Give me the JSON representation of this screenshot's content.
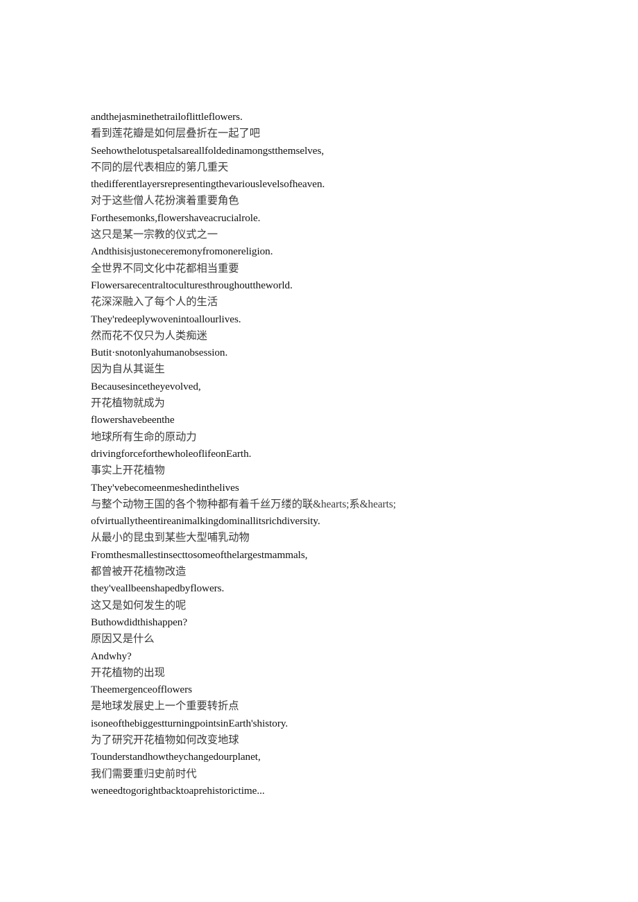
{
  "document": {
    "background_color": "#ffffff",
    "text_color_en": "#111111",
    "text_color_zh": "#3a3a3a",
    "lines": [
      {
        "lang": "en",
        "text": "andthejasminethetrailoflittleflowers."
      },
      {
        "lang": "zh",
        "text": "看到莲花瓣是如何层叠折在一起了吧"
      },
      {
        "lang": "en",
        "text": "Seehowthelotuspetalsareallfoldedinamongstthemselves,"
      },
      {
        "lang": "zh",
        "text": "不同的层代表相应的第几重天"
      },
      {
        "lang": "en",
        "text": "thedifferentlayersrepresentingthevariouslevelsofheaven."
      },
      {
        "lang": "zh",
        "text": "对于这些僧人花扮演着重要角色"
      },
      {
        "lang": "en",
        "text": "Forthesemonks,flowershaveacrucialrole."
      },
      {
        "lang": "zh",
        "text": "这只是某一宗教的仪式之一"
      },
      {
        "lang": "en",
        "text": "Andthisisjustoneceremonyfromonereligion."
      },
      {
        "lang": "zh",
        "text": "全世界不同文化中花都相当重要"
      },
      {
        "lang": "en",
        "text": "Flowersarecentraltoculturesthroughouttheworld."
      },
      {
        "lang": "zh",
        "text": "花深深融入了每个人的生活"
      },
      {
        "lang": "en",
        "text": "They'redeeplywovenintoallourlives."
      },
      {
        "lang": "zh",
        "text": "然而花不仅只为人类痴迷"
      },
      {
        "lang": "en",
        "text": "Butit·snotonlyahumanobsession."
      },
      {
        "lang": "zh",
        "text": "因为自从其诞生"
      },
      {
        "lang": "en",
        "text": "Becausesincetheyevolved,"
      },
      {
        "lang": "zh",
        "text": "开花植物就成为"
      },
      {
        "lang": "en",
        "text": "flowershavebeenthe"
      },
      {
        "lang": "zh",
        "text": "地球所有生命的原动力"
      },
      {
        "lang": "en",
        "text": "drivingforceforthewholeoflifeonEarth."
      },
      {
        "lang": "zh",
        "text": "事实上开花植物"
      },
      {
        "lang": "en",
        "text": "They'vebecomeenmeshedinthelives"
      },
      {
        "lang": "zh",
        "text": "与整个动物王国的各个物种都有着千丝万缕的联&hearts;系&hearts;"
      },
      {
        "lang": "en",
        "text": "ofvirtuallytheentireanimalkingdominallitsrichdiversity."
      },
      {
        "lang": "zh",
        "text": "从最小的昆虫到某些大型哺乳动物"
      },
      {
        "lang": "en",
        "text": "Fromthesmallestinsecttosomeofthelargestmammals,"
      },
      {
        "lang": "zh",
        "text": "都曾被开花植物改造"
      },
      {
        "lang": "en",
        "text": "they'veallbeenshapedbyflowers."
      },
      {
        "lang": "zh",
        "text": "这又是如何发生的呢"
      },
      {
        "lang": "en",
        "text": "Buthowdidthishappen?"
      },
      {
        "lang": "zh",
        "text": "原因又是什么"
      },
      {
        "lang": "en",
        "text": "Andwhy?"
      },
      {
        "lang": "zh",
        "text": "开花植物的出现"
      },
      {
        "lang": "en",
        "text": "Theemergenceofflowers"
      },
      {
        "lang": "zh",
        "text": "是地球发展史上一个重要转折点"
      },
      {
        "lang": "en",
        "text": "isoneofthebiggestturningpointsinEarth'shistory."
      },
      {
        "lang": "zh",
        "text": "为了研究开花植物如何改变地球"
      },
      {
        "lang": "en",
        "text": "Tounderstandhowtheychangedourplanet,"
      },
      {
        "lang": "zh",
        "text": "我们需要重归史前时代"
      },
      {
        "lang": "en",
        "text": "weneedtogorightbacktoaprehistorictime..."
      }
    ]
  }
}
